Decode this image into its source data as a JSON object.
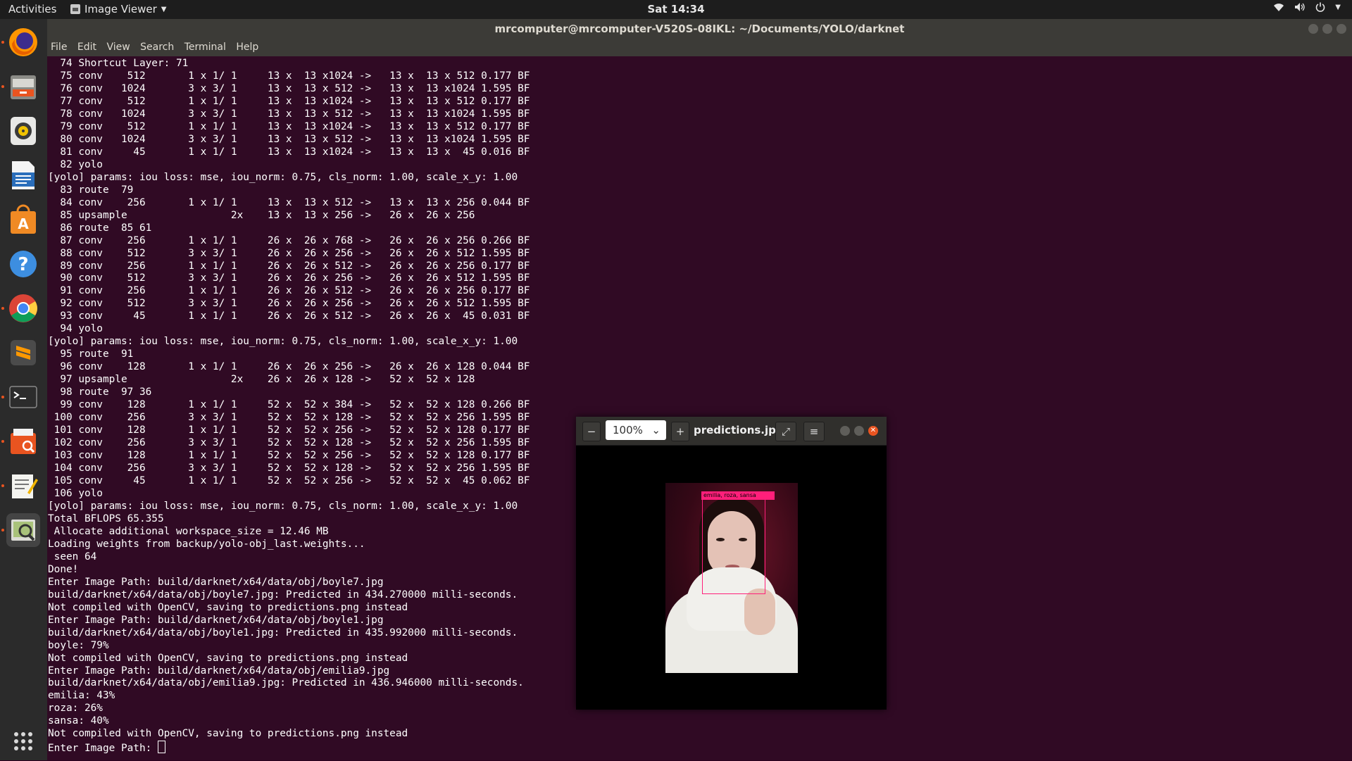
{
  "topbar": {
    "activities": "Activities",
    "app_name": "Image Viewer",
    "app_menu_icon": "chevron-down-icon",
    "clock": "Sat 14:34",
    "tray_icons": [
      "wifi-icon",
      "volume-icon",
      "power-icon",
      "chevron-down-icon"
    ]
  },
  "dock": {
    "items": [
      {
        "name": "firefox",
        "icon": "firefox-icon",
        "running": true
      },
      {
        "name": "files",
        "icon": "files-icon",
        "running": true
      },
      {
        "name": "rhythmbox",
        "icon": "rhythmbox-icon",
        "running": false
      },
      {
        "name": "libreoffice-writer",
        "icon": "writer-icon",
        "running": false
      },
      {
        "name": "software",
        "icon": "software-center-icon",
        "running": false
      },
      {
        "name": "help",
        "icon": "help-icon",
        "running": false
      },
      {
        "name": "chrome",
        "icon": "chrome-icon",
        "running": true
      },
      {
        "name": "sublime-text",
        "icon": "sublime-icon",
        "running": false
      },
      {
        "name": "terminal",
        "icon": "terminal-icon",
        "running": true
      },
      {
        "name": "document-viewer",
        "icon": "document-viewer-icon",
        "running": true
      },
      {
        "name": "text-editor",
        "icon": "text-editor-icon",
        "running": true
      },
      {
        "name": "image-viewer",
        "icon": "image-viewer-icon",
        "running": true,
        "active": true
      }
    ],
    "show_apps_icon": "grid-icon"
  },
  "terminal": {
    "title": "mrcomputer@mrcomputer-V520S-08IKL: ~/Documents/YOLO/darknet",
    "menu": [
      "File",
      "Edit",
      "View",
      "Search",
      "Terminal",
      "Help"
    ],
    "output": "  74 Shortcut Layer: 71\n  75 conv    512       1 x 1/ 1     13 x  13 x1024 ->   13 x  13 x 512 0.177 BF\n  76 conv   1024       3 x 3/ 1     13 x  13 x 512 ->   13 x  13 x1024 1.595 BF\n  77 conv    512       1 x 1/ 1     13 x  13 x1024 ->   13 x  13 x 512 0.177 BF\n  78 conv   1024       3 x 3/ 1     13 x  13 x 512 ->   13 x  13 x1024 1.595 BF\n  79 conv    512       1 x 1/ 1     13 x  13 x1024 ->   13 x  13 x 512 0.177 BF\n  80 conv   1024       3 x 3/ 1     13 x  13 x 512 ->   13 x  13 x1024 1.595 BF\n  81 conv     45       1 x 1/ 1     13 x  13 x1024 ->   13 x  13 x  45 0.016 BF\n  82 yolo\n[yolo] params: iou loss: mse, iou_norm: 0.75, cls_norm: 1.00, scale_x_y: 1.00\n  83 route  79\n  84 conv    256       1 x 1/ 1     13 x  13 x 512 ->   13 x  13 x 256 0.044 BF\n  85 upsample                 2x    13 x  13 x 256 ->   26 x  26 x 256\n  86 route  85 61\n  87 conv    256       1 x 1/ 1     26 x  26 x 768 ->   26 x  26 x 256 0.266 BF\n  88 conv    512       3 x 3/ 1     26 x  26 x 256 ->   26 x  26 x 512 1.595 BF\n  89 conv    256       1 x 1/ 1     26 x  26 x 512 ->   26 x  26 x 256 0.177 BF\n  90 conv    512       3 x 3/ 1     26 x  26 x 256 ->   26 x  26 x 512 1.595 BF\n  91 conv    256       1 x 1/ 1     26 x  26 x 512 ->   26 x  26 x 256 0.177 BF\n  92 conv    512       3 x 3/ 1     26 x  26 x 256 ->   26 x  26 x 512 1.595 BF\n  93 conv     45       1 x 1/ 1     26 x  26 x 512 ->   26 x  26 x  45 0.031 BF\n  94 yolo\n[yolo] params: iou loss: mse, iou_norm: 0.75, cls_norm: 1.00, scale_x_y: 1.00\n  95 route  91\n  96 conv    128       1 x 1/ 1     26 x  26 x 256 ->   26 x  26 x 128 0.044 BF\n  97 upsample                 2x    26 x  26 x 128 ->   52 x  52 x 128\n  98 route  97 36\n  99 conv    128       1 x 1/ 1     52 x  52 x 384 ->   52 x  52 x 128 0.266 BF\n 100 conv    256       3 x 3/ 1     52 x  52 x 128 ->   52 x  52 x 256 1.595 BF\n 101 conv    128       1 x 1/ 1     52 x  52 x 256 ->   52 x  52 x 128 0.177 BF\n 102 conv    256       3 x 3/ 1     52 x  52 x 128 ->   52 x  52 x 256 1.595 BF\n 103 conv    128       1 x 1/ 1     52 x  52 x 256 ->   52 x  52 x 128 0.177 BF\n 104 conv    256       3 x 3/ 1     52 x  52 x 128 ->   52 x  52 x 256 1.595 BF\n 105 conv     45       1 x 1/ 1     52 x  52 x 256 ->   52 x  52 x  45 0.062 BF\n 106 yolo\n[yolo] params: iou loss: mse, iou_norm: 0.75, cls_norm: 1.00, scale_x_y: 1.00\nTotal BFLOPS 65.355\n Allocate additional workspace_size = 12.46 MB\nLoading weights from backup/yolo-obj_last.weights...\n seen 64\nDone!\nEnter Image Path: build/darknet/x64/data/obj/boyle7.jpg\nbuild/darknet/x64/data/obj/boyle7.jpg: Predicted in 434.270000 milli-seconds.\nNot compiled with OpenCV, saving to predictions.png instead\nEnter Image Path: build/darknet/x64/data/obj/boyle1.jpg\nbuild/darknet/x64/data/obj/boyle1.jpg: Predicted in 435.992000 milli-seconds.\nboyle: 79%\nNot compiled with OpenCV, saving to predictions.png instead\nEnter Image Path: build/darknet/x64/data/obj/emilia9.jpg\nbuild/darknet/x64/data/obj/emilia9.jpg: Predicted in 436.946000 milli-seconds.\nemilia: 43%\nroza: 26%\nsansa: 40%\nNot compiled with OpenCV, saving to predictions.png instead\n",
    "prompt": "Enter Image Path: "
  },
  "viewer": {
    "zoom_out_icon": "zoom-out-icon",
    "zoom_value": "100%",
    "zoom_in_icon": "zoom-in-icon",
    "title": "predictions.jpg",
    "fullscreen_icon": "fullscreen-icon",
    "menu_icon": "hamburger-menu-icon",
    "detection_label": "emilia, roza, sansa",
    "detection_color": "#ff1f7a"
  },
  "colors": {
    "terminal_bg": "#300a24",
    "accent": "#e95420"
  }
}
